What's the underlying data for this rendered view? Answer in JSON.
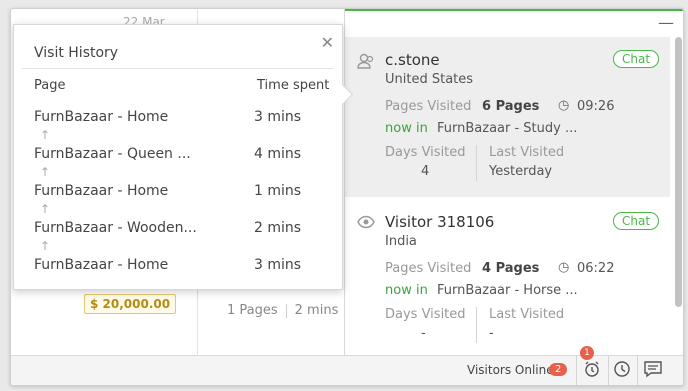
{
  "background": {
    "date": "22 Mar",
    "amount": "$ 20,000.00",
    "pages": "1 Pages",
    "time": "2 mins"
  },
  "visit_history": {
    "title": "Visit History",
    "col_page": "Page",
    "col_time": "Time spent",
    "rows": [
      {
        "page": "FurnBazaar - Home",
        "time": "3 mins"
      },
      {
        "page": "FurnBazaar - Queen ...",
        "time": "4 mins"
      },
      {
        "page": "FurnBazaar - Home",
        "time": "1 mins"
      },
      {
        "page": "FurnBazaar - Wooden...",
        "time": "2 mins"
      },
      {
        "page": "FurnBazaar - Home",
        "time": "3 mins"
      }
    ],
    "arrow": "↑"
  },
  "visitors": [
    {
      "name": "c.stone",
      "country": "United States",
      "chat": "Chat",
      "pages_visited_label": "Pages Visited",
      "pages": "6 Pages",
      "duration": "09:26",
      "now_in_label": "now in",
      "now_in_page": "FurnBazaar - Study ...",
      "days_visited_label": "Days Visited",
      "days_visited": "4",
      "last_visited_label": "Last Visited",
      "last_visited": "Yesterday",
      "icon": "user-icon"
    },
    {
      "name": "Visitor 318106",
      "country": "India",
      "chat": "Chat",
      "pages_visited_label": "Pages Visited",
      "pages": "4 Pages",
      "duration": "06:22",
      "now_in_label": "now in",
      "now_in_page": "FurnBazaar - Horse ...",
      "days_visited_label": "Days Visited",
      "days_visited": "-",
      "last_visited_label": "Last Visited",
      "last_visited": "-",
      "icon": "eye-icon"
    }
  ],
  "bottom_bar": {
    "visitors_online_label": "Visitors Online",
    "visitors_online_count": "2",
    "notification_count": "1"
  },
  "colors": {
    "accent_green": "#49b847",
    "badge_red": "#e8604c"
  }
}
